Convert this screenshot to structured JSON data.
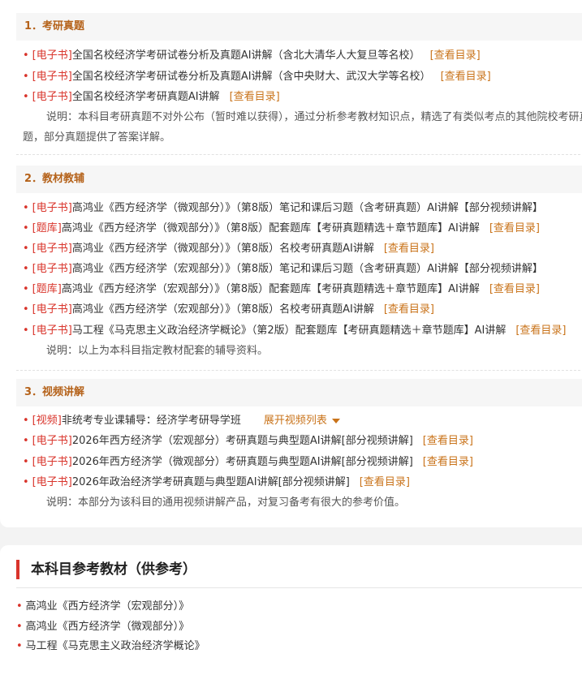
{
  "sections": [
    {
      "title": "1．考研真题",
      "items": [
        {
          "tag": "[电子书]",
          "title": "全国名校经济学考研试卷分析及真题AI讲解（含北大清华人大复旦等名校）",
          "link": "[查看目录]"
        },
        {
          "tag": "[电子书]",
          "title": "全国名校经济学考研试卷分析及真题AI讲解（含中央财大、武汉大学等名校）",
          "link": "[查看目录]"
        },
        {
          "tag": "[电子书]",
          "title": "全国名校经济学考研真题AI讲解",
          "link": "[查看目录]"
        }
      ],
      "note_line1": "说明：本科目考研真题不对外公布（暂时难以获得），通过分析参考教材知识点，精选了有类似考点的其他院校考研真",
      "note_line2": "题，部分真题提供了答案详解。"
    },
    {
      "title": "2．教材教辅",
      "items": [
        {
          "tag": "[电子书]",
          "title": "高鸿业《西方经济学（微观部分）》（第8版）笔记和课后习题（含考研真题）AI讲解【部分视频讲解】",
          "link": ""
        },
        {
          "tag": "[题库]",
          "title": "高鸿业《西方经济学（微观部分）》（第8版）配套题库【考研真题精选＋章节题库】AI讲解",
          "link": "[查看目录]"
        },
        {
          "tag": "[电子书]",
          "title": "高鸿业《西方经济学（微观部分）》（第8版）名校考研真题AI讲解",
          "link": "[查看目录]"
        },
        {
          "tag": "[电子书]",
          "title": "高鸿业《西方经济学（宏观部分）》（第8版）笔记和课后习题（含考研真题）AI讲解【部分视频讲解】",
          "link": ""
        },
        {
          "tag": "[题库]",
          "title": "高鸿业《西方经济学（宏观部分）》（第8版）配套题库【考研真题精选＋章节题库】AI讲解",
          "link": "[查看目录]"
        },
        {
          "tag": "[电子书]",
          "title": "高鸿业《西方经济学（宏观部分）》（第8版）名校考研真题AI讲解",
          "link": "[查看目录]"
        },
        {
          "tag": "[电子书]",
          "title": "马工程《马克思主义政治经济学概论》（第2版）配套题库【考研真题精选＋章节题库】AI讲解",
          "link": "[查看目录]"
        }
      ],
      "note_line1": "说明：以上为本科目指定教材配套的辅导资料。"
    },
    {
      "title": "3．视频讲解",
      "items": [
        {
          "tag": "[视频]",
          "title": "非统考专业课辅导：经济学考研导学班",
          "link": "展开视频列表"
        },
        {
          "tag": "[电子书]",
          "title": "2026年西方经济学（宏观部分）考研真题与典型题AI讲解[部分视频讲解]",
          "link": "[查看目录]"
        },
        {
          "tag": "[电子书]",
          "title": "2026年西方经济学（微观部分）考研真题与典型题AI讲解[部分视频讲解]",
          "link": "[查看目录]"
        },
        {
          "tag": "[电子书]",
          "title": "2026年政治经济学考研真题与典型题AI讲解[部分视频讲解]",
          "link": "[查看目录]"
        }
      ],
      "note_line1": "说明：本部分为该科目的通用视频讲解产品，对复习备考有很大的参考价值。"
    }
  ],
  "reference": {
    "title": "本科目参考教材（供参考）",
    "books": [
      "高鸿业《西方经济学（宏观部分）》",
      "高鸿业《西方经济学（微观部分）》",
      "马工程《马克思主义政治经济学概论》"
    ]
  },
  "colors": {
    "accent_red": "#d9342b",
    "link_orange": "#c9731a",
    "heading_brown": "#b5621a"
  }
}
